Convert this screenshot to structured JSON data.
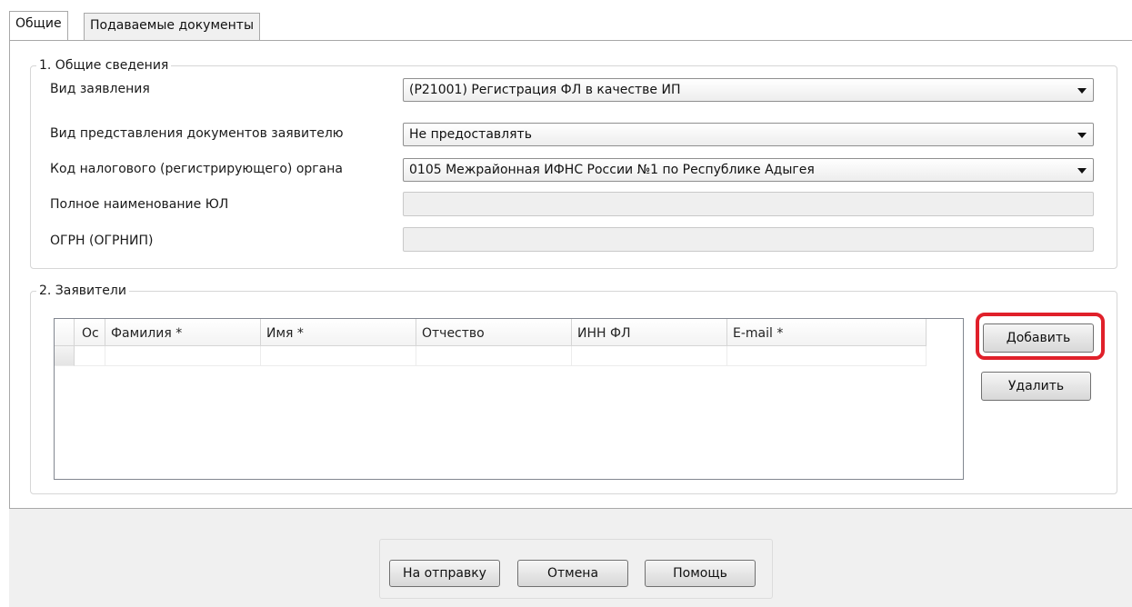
{
  "tabs": [
    {
      "label": "Общие",
      "active": true
    },
    {
      "label": "Подаваемые документы",
      "active": false
    }
  ],
  "general": {
    "legend": "1. Общие сведения",
    "fields": [
      {
        "label": "Вид заявления",
        "value": "(Р21001) Регистрация ФЛ в качестве ИП",
        "type": "dropdown"
      },
      {
        "label": "Вид представления документов заявителю",
        "value": "Не предоставлять",
        "type": "dropdown"
      },
      {
        "label": "Код налогового (регистрирующего) органа",
        "value": "0105 Межрайонная ИФНС России №1 по Республике Адыгея",
        "type": "dropdown"
      },
      {
        "label": "Полное наименование ЮЛ",
        "value": "",
        "type": "disabled"
      },
      {
        "label": "ОГРН (ОГРНИП)",
        "value": "",
        "type": "disabled"
      }
    ]
  },
  "applicants": {
    "legend": "2. Заявители",
    "columns": [
      "Ос",
      "Фамилия *",
      "Имя *",
      "Отчество",
      "ИНН ФЛ",
      "E-mail *"
    ],
    "add_label": "Добавить",
    "delete_label": "Удалить"
  },
  "footer": {
    "send_label": "На отправку",
    "cancel_label": "Отмена",
    "help_label": "Помощь"
  },
  "colors": {
    "highlight_ring": "#e0202a"
  }
}
